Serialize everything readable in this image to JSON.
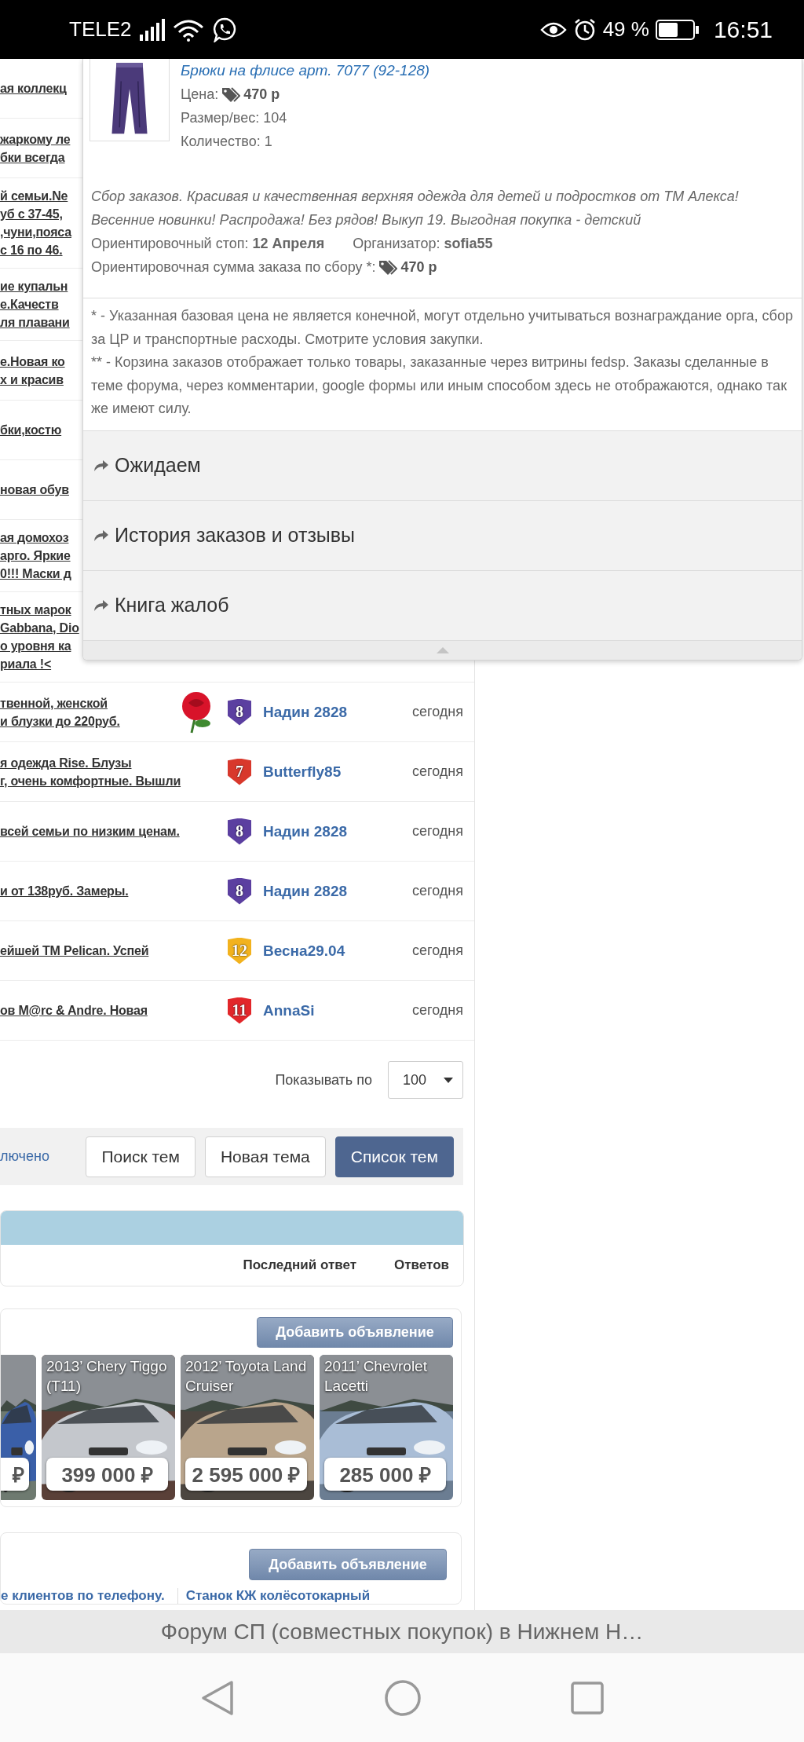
{
  "status_bar": {
    "carrier": "TELE2",
    "battery": "49 %",
    "time": "16:51"
  },
  "topics": [
    {
      "title_lines": [
        "ая коллекц"
      ]
    },
    {
      "title_lines": [
        "жаркому ле",
        "бки всегда"
      ]
    },
    {
      "title_lines": [
        "й семьи.Ne",
        "уб с 37-45,",
        ",чуни,пояса",
        "с 16 по 46."
      ]
    },
    {
      "title_lines": [
        "ие купальн",
        "е.Качеств",
        "ля плавани"
      ]
    },
    {
      "title_lines": [
        "е.Новая ко",
        "х и красив"
      ]
    },
    {
      "title_lines": [
        "бки,костю"
      ]
    },
    {
      "title_lines": [
        "новая обув"
      ]
    },
    {
      "title_lines": [
        "ая домохоз",
        "арго. Яркие",
        "0!!! Маски д"
      ]
    },
    {
      "title_lines": [
        "тных марок",
        "Gabbana, Dio",
        "о уровня ка",
        "риала !<"
      ]
    },
    {
      "title_lines": [
        "твенной, женской",
        "и блузки до 220руб."
      ],
      "flower": true,
      "rank": "8",
      "color": "#5b3fa0",
      "author": "Надин 2828",
      "date": "сегодня"
    },
    {
      "title_lines": [
        "я одежда Rise. Блузы",
        "г, очень комфортные. Вышли"
      ],
      "flower": false,
      "rank": "7",
      "color": "#d8382c",
      "author": "Butterfly85",
      "date": "сегодня"
    },
    {
      "title_lines": [
        "всей семьи по низким ценам."
      ],
      "flower": false,
      "rank": "8",
      "color": "#5b3fa0",
      "author": "Надин 2828",
      "date": "сегодня"
    },
    {
      "title_lines": [
        "и от 138руб. Замеры."
      ],
      "flower": false,
      "rank": "8",
      "color": "#5b3fa0",
      "author": "Надин 2828",
      "date": "сегодня"
    },
    {
      "title_lines": [
        "ейшей TM Pelican. Успей"
      ],
      "flower": false,
      "rank": "12",
      "color": "#f2b21e",
      "author": "Весна29.04",
      "date": "сегодня"
    },
    {
      "title_lines": [
        "ов M@rc & Andre. Новая"
      ],
      "flower": false,
      "rank": "11",
      "color": "#e2262a",
      "author": "AnnaSi",
      "date": "сегодня"
    }
  ],
  "popup": {
    "product": {
      "title": "Брюки на флисе арт. 7077 (92-128)",
      "price_label": "Цена:",
      "price": "470 р",
      "size": "Размер/вес: 104",
      "quantity": "Количество: 1"
    },
    "description": "Сбор заказов. Красивая и качественная верхняя одежда для детей и подростков от ТМ Алекса! Весенние новинки! Распродажа! Без рядов! Выкуп 19. Выгодная покупка - детский",
    "stop": "Ориентировочный стоп: **12 Апреля**",
    "organizer": "Организатор: **sofia55**",
    "sum_label": "Ориентировочная сумма заказа по сбору *:",
    "sum": "470 р",
    "notes": [
      "* - Указанная базовая цена не является конечной, могут отдельно учитываться вознаграждание орга, сбор за ЦР и транспортные расходы. Смотрите условия закупки.",
      "** - Корзина заказов отображает только товары, заказанные через витрины fedsp. Заказы сделанные в теме форума, через комментарии, google формы или иным способом здесь не отображаются, однако так же имеют силу."
    ],
    "menu": [
      {
        "label": "Ожидаем"
      },
      {
        "label": "История заказов и отзывы"
      },
      {
        "label": "Книга жалоб"
      }
    ]
  },
  "pagination": {
    "label": "Показывать по",
    "value": "100"
  },
  "toolbar": {
    "status_link": "лючено",
    "buttons": [
      {
        "label": "Поиск тем",
        "kind": "default"
      },
      {
        "label": "Новая тема",
        "kind": "default"
      },
      {
        "label": "Список тем",
        "kind": "primary"
      }
    ]
  },
  "table_header": {
    "columns": [
      "Последний ответ",
      "Ответов"
    ]
  },
  "car_ads": {
    "button": "Добавить объявление",
    "cars": [
      {
        "kind": "partial",
        "price": "₽"
      },
      {
        "kind": "full",
        "title": "2013’ Chery Tiggo (T11)",
        "price": "399 000 ₽"
      },
      {
        "kind": "full",
        "title": "2012’ Toyota Land Cruiser",
        "price": "2 595 000 ₽"
      },
      {
        "kind": "full",
        "title": "2011’ Chevrolet Lacetti",
        "price": "285 000 ₽"
      }
    ]
  },
  "classifieds": {
    "button": "Добавить объявление",
    "links": [
      "е клиентов по телефону.",
      "Станок КЖ колёсотокарный"
    ]
  },
  "browser_title": "Форум СП (совместных покупок) в Нижнем Н…"
}
